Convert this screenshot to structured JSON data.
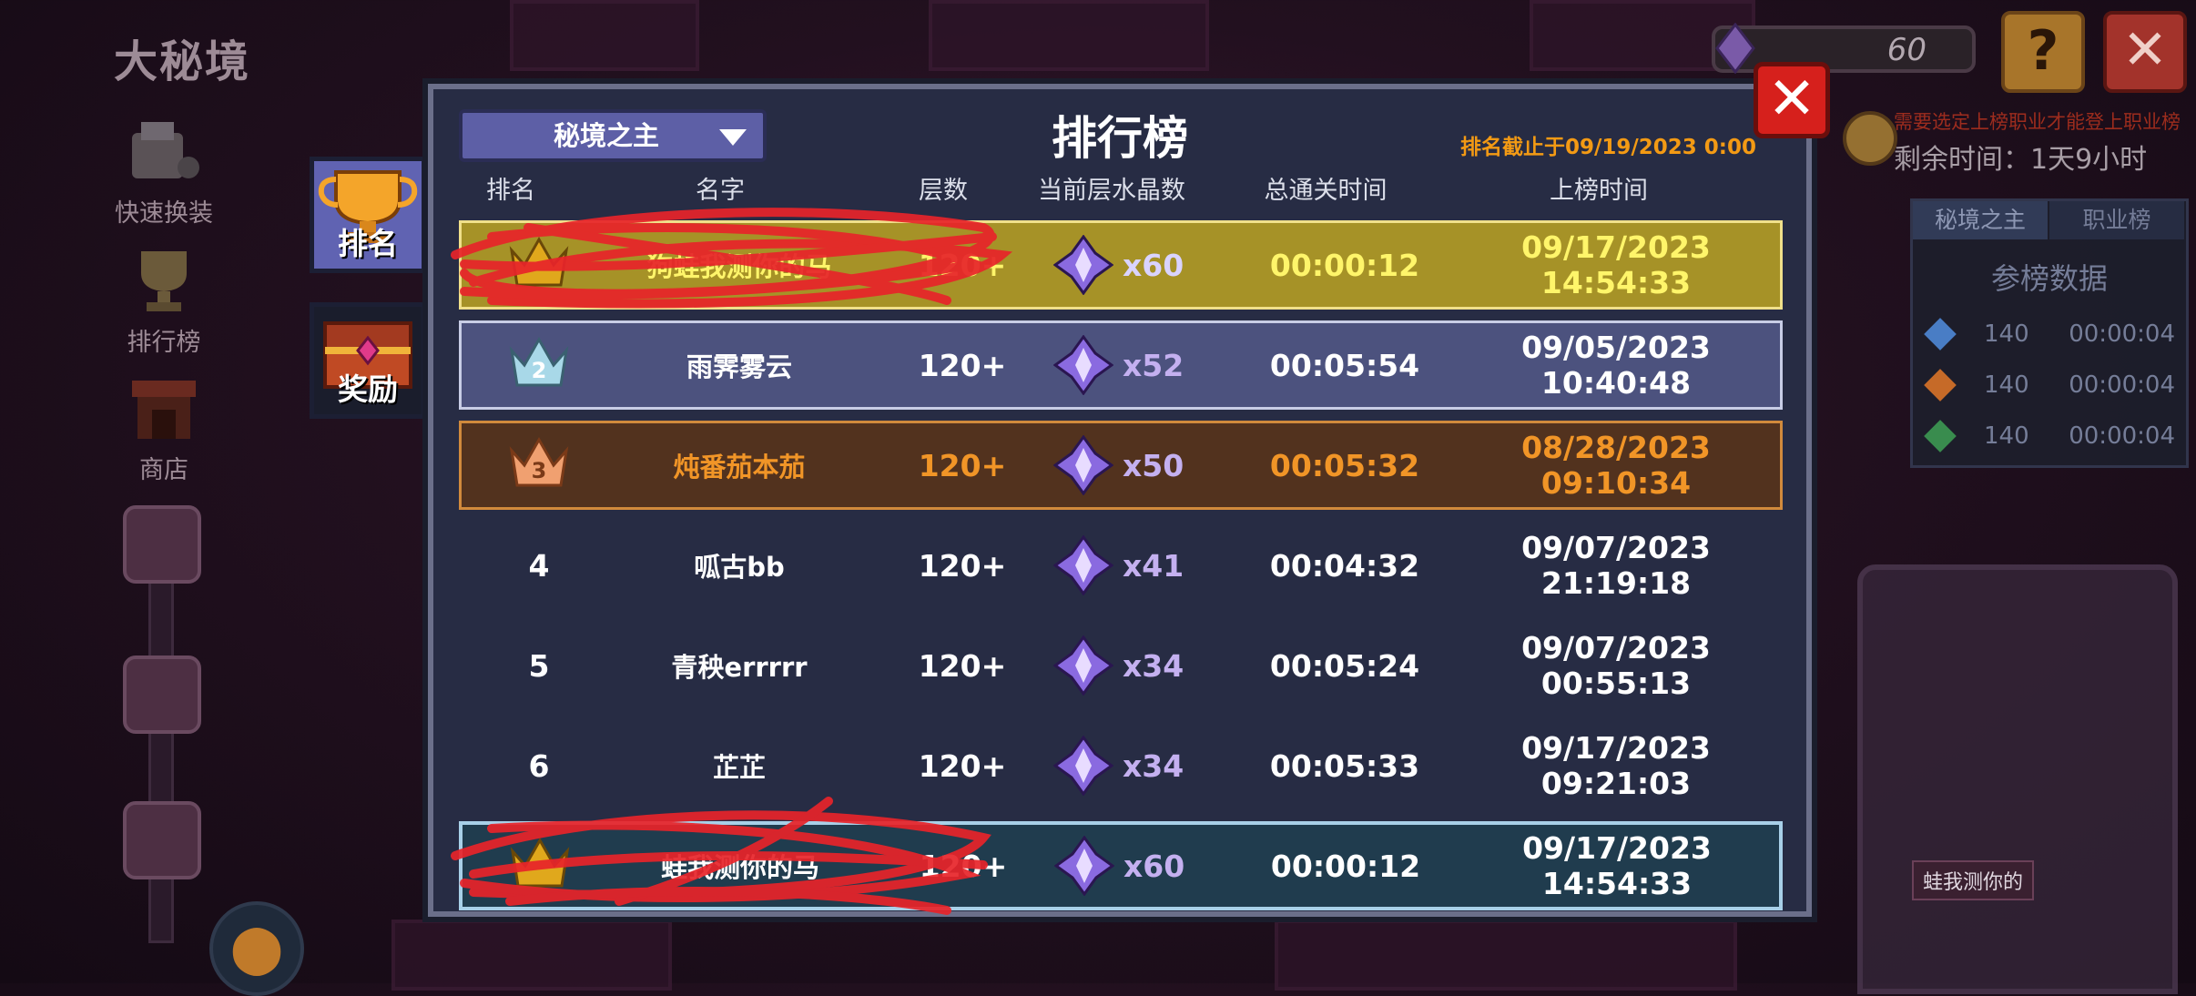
{
  "app": {
    "mode_title": "大秘境"
  },
  "side_menu": [
    {
      "label": "快速换装",
      "icon": "armor-swap-icon"
    },
    {
      "label": "排行榜",
      "icon": "trophy-icon"
    },
    {
      "label": "商店",
      "icon": "shop-icon"
    }
  ],
  "top_right": {
    "counter_value": "60",
    "help_label": "?",
    "close_label": "✕"
  },
  "right_panel": {
    "note": "需要选定上榜职业才能登上职业榜",
    "time_left": "剩余时间：1天9小时",
    "tabs": [
      "秘境之主",
      "职业榜"
    ],
    "heading": "参榜数据",
    "rows": [
      {
        "icon": "blue-crystal-icon",
        "level": "140",
        "time": "00:00:04",
        "color": "#4e8ad8"
      },
      {
        "icon": "fire-icon",
        "level": "140",
        "time": "00:00:04",
        "color": "#d8742a"
      },
      {
        "icon": "green-crystal-icon",
        "level": "140",
        "time": "00:00:04",
        "color": "#3c9a54"
      }
    ],
    "statue_caption": "蛙我测你的"
  },
  "dialog": {
    "dropdown": "秘境之主",
    "title": "排行榜",
    "deadline": "排名截止于09/19/2023 0:00",
    "close_label": "✕",
    "tabs": [
      {
        "label": "排名",
        "icon": "trophy-icon"
      },
      {
        "label": "奖励",
        "icon": "treasure-chest-icon"
      }
    ],
    "headers": [
      "排名",
      "名字",
      "层数",
      "当前层水晶数",
      "总通关时间",
      "上榜时间"
    ],
    "rows": [
      {
        "rank": "1",
        "name": "狗蛙我测你的马",
        "floors": "120+",
        "crystals": "x60",
        "total": "00:00:12",
        "date": "09/17/2023 14:54:33",
        "style": "r1",
        "redacted": true
      },
      {
        "rank": "2",
        "name": "雨霁雾云",
        "floors": "120+",
        "crystals": "x52",
        "total": "00:05:54",
        "date": "09/05/2023 10:40:48",
        "style": "r2"
      },
      {
        "rank": "3",
        "name": "炖番茄本茄",
        "floors": "120+",
        "crystals": "x50",
        "total": "00:05:32",
        "date": "08/28/2023 09:10:34",
        "style": "r3"
      },
      {
        "rank": "4",
        "name": "呱古bb",
        "floors": "120+",
        "crystals": "x41",
        "total": "00:04:32",
        "date": "09/07/2023 21:19:18",
        "style": "plain"
      },
      {
        "rank": "5",
        "name": "青秧errrrr",
        "floors": "120+",
        "crystals": "x34",
        "total": "00:05:24",
        "date": "09/07/2023 00:55:13",
        "style": "plain"
      },
      {
        "rank": "6",
        "name": "芷芷",
        "floors": "120+",
        "crystals": "x34",
        "total": "00:05:33",
        "date": "09/17/2023 09:21:03",
        "style": "plain"
      }
    ],
    "my_row": {
      "rank": "1",
      "name": "蛙我测你的马",
      "floors": "120+",
      "crystals": "x60",
      "total": "00:00:12",
      "date": "09/17/2023 14:54:33",
      "redacted": true
    },
    "colors": {
      "gold": "#a69227",
      "silver": "#4c527e",
      "bronze": "#52321e",
      "me": "#203c4e",
      "accent": "#f39a14"
    }
  }
}
